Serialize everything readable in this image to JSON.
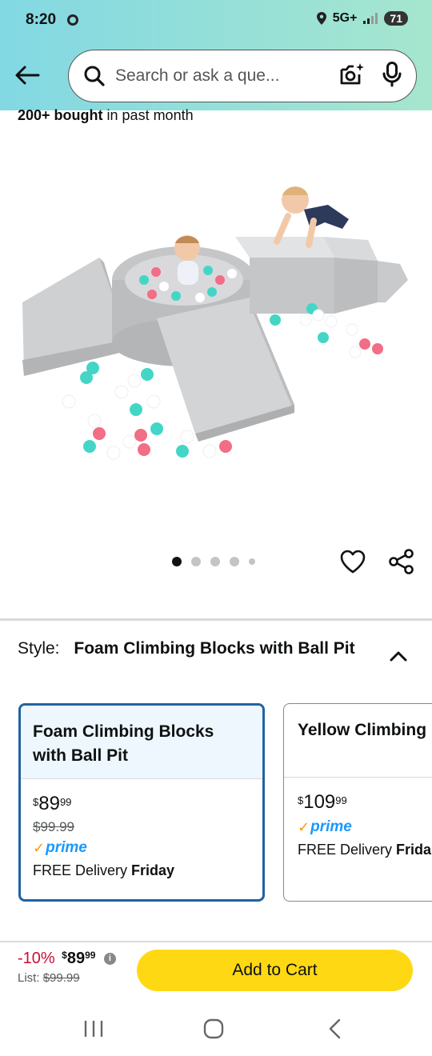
{
  "status_bar": {
    "time": "8:20",
    "network": "5G+",
    "battery": "71"
  },
  "search": {
    "placeholder": "Search or ask a question",
    "display_text": "Search or ask a que..."
  },
  "product": {
    "bought_count": "200+ bought",
    "bought_suffix": "in past month",
    "image_count": 5,
    "active_image": 0
  },
  "style_selector": {
    "label": "Style:",
    "selected_value": "Foam Climbing Blocks with Ball Pit",
    "options": [
      {
        "name": "Foam Climbing Blocks with Ball Pit",
        "price_whole": "89",
        "price_fraction": "99",
        "price_currency": "$",
        "list_price": "$99.99",
        "prime": "prime",
        "delivery_prefix": "FREE Delivery",
        "delivery_day": "Friday"
      },
      {
        "name": "Yellow Climbing",
        "price_whole": "109",
        "price_fraction": "99",
        "price_currency": "$",
        "prime": "prime",
        "delivery_prefix": "FREE Delivery",
        "delivery_day": "Frida"
      }
    ]
  },
  "buy_bar": {
    "discount": "-10%",
    "price_currency": "$",
    "price_whole": "89",
    "price_fraction": "99",
    "list_label": "List:",
    "list_price": "$99.99",
    "add_to_cart": "Add to Cart"
  },
  "colors": {
    "header_gradient_start": "#82d8e3",
    "header_gradient_end": "#a6e6ce",
    "selected_border": "#2162a1",
    "add_to_cart": "#ffd814",
    "discount": "#cc0c39",
    "prime_blue": "#1a98ff",
    "prime_check": "#ff9900"
  }
}
